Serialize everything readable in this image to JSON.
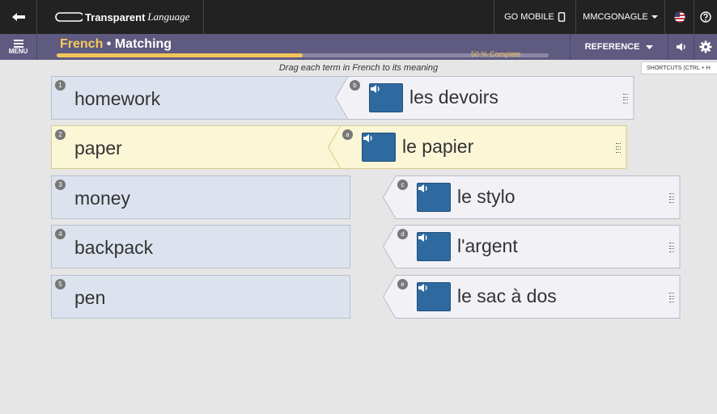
{
  "topbar": {
    "brand": "Transparent",
    "brand_suffix": "Language",
    "go_mobile": "GO MOBILE",
    "user": "MMCGONAGLE",
    "icons": {
      "back": "arrow-left-icon",
      "mobile": "phone-icon",
      "flag": "us-flag-icon",
      "help": "help-icon"
    }
  },
  "subbar": {
    "menu_label": "MENU",
    "title_language": "French",
    "title_separator": " • ",
    "title_activity": "Matching",
    "progress_text": "50 % Complete",
    "progress_percent": 50,
    "reference": "REFERENCE",
    "shortcuts": "SHORTCUTS (CTRL + H"
  },
  "instruction": "Drag each term in French to its meaning",
  "terms": [
    {
      "num": "1",
      "label": "homework"
    },
    {
      "num": "2",
      "label": "paper"
    },
    {
      "num": "3",
      "label": "money"
    },
    {
      "num": "4",
      "label": "backpack"
    },
    {
      "num": "5",
      "label": "pen"
    }
  ],
  "meanings": [
    {
      "letter": "b",
      "label": "les devoirs"
    },
    {
      "letter": "a",
      "label": "le papier"
    },
    {
      "letter": "c",
      "label": "le stylo"
    },
    {
      "letter": "d",
      "label": "l'argent"
    },
    {
      "letter": "e",
      "label": "le sac à dos"
    }
  ],
  "colors": {
    "topbar": "#222222",
    "subbar": "#5f5a7f",
    "accent_yellow": "#f3c45a",
    "term_bg": "#dde3ee",
    "active_bg": "#fbf6d6",
    "meaning_bg": "#f2f1f6",
    "audio_btn": "#2e6aa0"
  }
}
